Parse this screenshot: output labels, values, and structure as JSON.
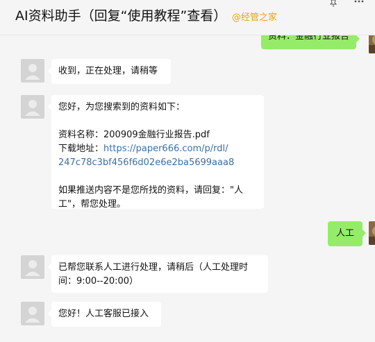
{
  "header": {
    "title": "AI资料助手（回复“使用教程”查看）",
    "watermark": "@经管之家",
    "pin_icon": "pin-icon",
    "more_icon": "more-icon"
  },
  "messages": {
    "top_out": "资料：金融行业报告",
    "m1": "收到，正在处理，请稍等",
    "m2": {
      "greeting": "您好，为您搜索到的资料如下：",
      "name_label": "资料名称：",
      "name_value": "200909金融行业报告.pdf",
      "url_label": "下载地址：",
      "url_part1": "https://paper666.com/p/rdl/",
      "url_part2": "247c78c3bf456f6d02e6e2ba5699aaa8",
      "note_line1": "如果推送内容不是您所找的资料，请回复：\"人",
      "note_line2": "工\"，帮您处理。"
    },
    "out_rengong": "人工",
    "m3_line1": "已帮您联系人工进行处理，请稍后（人工处理时",
    "m3_line2": "间：9:00--20:00）",
    "m4": "您好！人工客服已接入"
  },
  "colors": {
    "out_bubble": "#95ec69",
    "in_bubble": "#ffffff",
    "link": "#3b6ea8",
    "watermark": "#e9a21b"
  }
}
